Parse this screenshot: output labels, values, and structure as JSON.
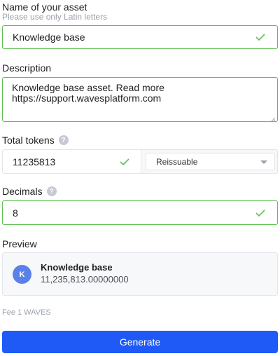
{
  "name_field": {
    "label": "Name of your asset",
    "hint": "Please use only Latin letters",
    "value": "Knowledge base"
  },
  "description_field": {
    "label": "Description",
    "lines": [
      "Knowledge base asset. Read more",
      "https://support.wavesplatform.com"
    ]
  },
  "tokens_field": {
    "label": "Total tokens",
    "help": "?",
    "value": "11235813",
    "reissuable_select": "Reissuable"
  },
  "decimals_field": {
    "label": "Decimals",
    "help": "?",
    "value": "8"
  },
  "preview": {
    "label": "Preview",
    "avatar_letter": "K",
    "name": "Knowledge base",
    "amount": "11,235,813.00000000"
  },
  "fee": "Fee 1 WAVES",
  "generate_label": "Generate",
  "colors": {
    "valid_border": "#5fbf52",
    "primary_button": "#1f5af6",
    "avatar": "#5a81ea"
  },
  "icons": {
    "valid": "check-icon",
    "help": "question-circle-icon",
    "select": "chevron-down-icon",
    "textarea": "resize-handle-icon"
  }
}
